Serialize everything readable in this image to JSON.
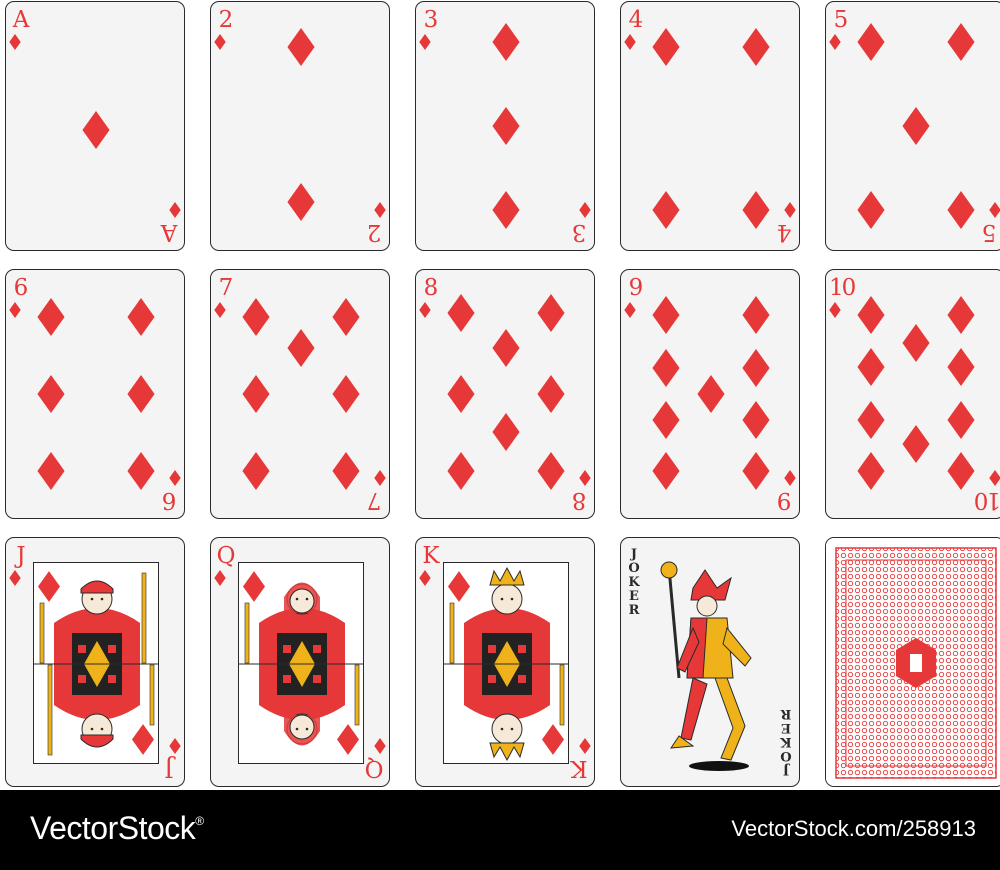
{
  "colors": {
    "red": "#e63838",
    "ink": "#2a2a2a",
    "gold": "#f0b21a",
    "card": "#f4f4f4"
  },
  "suit_icon": "diamond-icon",
  "cards": [
    {
      "rank": "A",
      "pips": 1
    },
    {
      "rank": "2",
      "pips": 2
    },
    {
      "rank": "3",
      "pips": 3
    },
    {
      "rank": "4",
      "pips": 4
    },
    {
      "rank": "5",
      "pips": 5
    },
    {
      "rank": "6",
      "pips": 6
    },
    {
      "rank": "7",
      "pips": 7
    },
    {
      "rank": "8",
      "pips": 8
    },
    {
      "rank": "9",
      "pips": 9
    },
    {
      "rank": "10",
      "pips": 10
    },
    {
      "rank": "J",
      "face": "jack"
    },
    {
      "rank": "Q",
      "face": "queen"
    },
    {
      "rank": "K",
      "face": "king"
    }
  ],
  "joker": {
    "label": "JOKER"
  },
  "card_back": {
    "icon": "card-back-pattern"
  },
  "footer": {
    "brand": "VectorStock",
    "trademark": "®",
    "ident": "VectorStock.com/258913"
  }
}
